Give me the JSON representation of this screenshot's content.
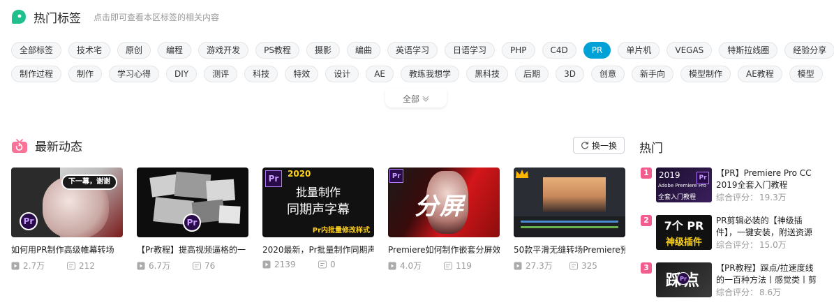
{
  "hot_tags": {
    "title": "热门标签",
    "subtitle": "点击即可查看本区标签的相关内容",
    "row1": [
      "全部标签",
      "技术宅",
      "原创",
      "编程",
      "游戏开发",
      "PS教程",
      "摄影",
      "编曲",
      "英语学习",
      "日语学习",
      "PHP",
      "C4D",
      "PR",
      "单片机",
      "VEGAS",
      "特斯拉线圈",
      "经验分享"
    ],
    "row2": [
      "制作过程",
      "制作",
      "学习心得",
      "DIY",
      "测评",
      "科技",
      "特效",
      "设计",
      "AE",
      "教练我想学",
      "黑科技",
      "后期",
      "3D",
      "创意",
      "新手向",
      "模型制作",
      "AE教程",
      "模型"
    ],
    "active": "PR",
    "expand_label": "全部"
  },
  "latest": {
    "title": "最新动态",
    "refresh_label": "换一换",
    "videos": [
      {
        "title": "如何用PR制作高级帷幕转场",
        "plays": "2.7万",
        "danmaku": "212",
        "thumb_text": "下一幕，谢谢"
      },
      {
        "title": "【Pr教程】提高视频逼格的一",
        "plays": "6.7万",
        "danmaku": "76",
        "thumb_text": ""
      },
      {
        "title": "2020最新，Pr批量制作同期声",
        "plays": "2139",
        "danmaku": "0",
        "thumb_text": "批量制作",
        "thumb_text2": "同期声字幕",
        "thumb_year": "2020",
        "thumb_caption": "Pr内批量修改样式"
      },
      {
        "title": "Premiere如何制作嵌套分屏效",
        "plays": "4.0万",
        "danmaku": "119",
        "thumb_text": "分屏"
      },
      {
        "title": "50款平滑无缝转场Premiere预",
        "plays": "27.3万",
        "danmaku": "325",
        "thumb_text": ""
      }
    ]
  },
  "hot": {
    "title": "热门",
    "score_label": "综合评分：",
    "items": [
      {
        "rank": "1",
        "title": "【PR】Premiere Pro CC 2019全套入门教程",
        "score": "19.3万",
        "thumb_line1": "2019",
        "thumb_line2": "Adobe Premiere Pro",
        "thumb_line3": "全套入门教程"
      },
      {
        "rank": "2",
        "title": "PR剪辑必装的【神级插件】，一键安装，附送资源",
        "score": "15.0万",
        "thumb_line1": "7个 PR",
        "thumb_line2": "神级插件"
      },
      {
        "rank": "3",
        "title": "【PR教程】踩点/拉速度线的一百种方法丨感觉类丨剪",
        "score": "8.6万",
        "thumb_line1": "踩点"
      }
    ]
  },
  "colors": {
    "accent": "#00a1d6",
    "rank": "#f25d8e",
    "tag_icon": "#1fc08e",
    "tv_icon": "#fb7299"
  }
}
